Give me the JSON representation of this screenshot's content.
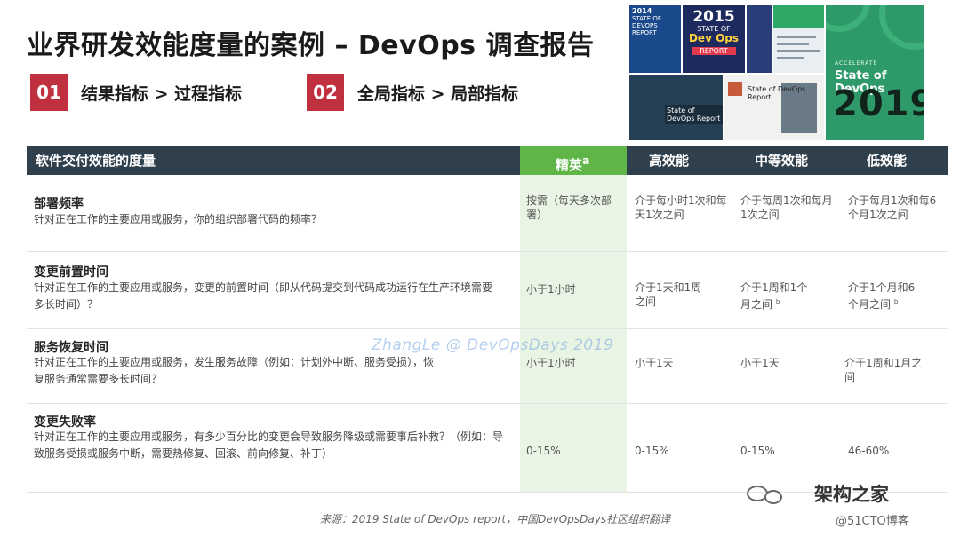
{
  "slide": {
    "title": "业界研发效能度量的案例 – DevOps 调查报告",
    "tags": [
      {
        "num": "01",
        "text": "结果指标 > 过程指标"
      },
      {
        "num": "02",
        "text": "全局指标 > 局部指标"
      }
    ]
  },
  "covers": {
    "c1_year": "2014",
    "c1_text": "STATE OF DEVOPS REPORT",
    "c2_year": "2015",
    "c2_state": "STATE OF",
    "c2_devops": "Dev Ops",
    "c2_report": "REPORT",
    "c6_text": "State of DevOps Report",
    "c7_text": "State of DevOps Report",
    "c5_accelerate": "ACCELERATE",
    "c5_title": "State of DevOps",
    "c5_year": "2019"
  },
  "table": {
    "headers": [
      "软件交付效能的度量",
      "精英",
      "高效能",
      "中等效能",
      "低效能"
    ],
    "elite_mark": "a",
    "rows": [
      {
        "metric": "部署频率",
        "desc": "针对正在工作的主要应用或服务，你的组织部署代码的频率？",
        "values": [
          "按需（每天多次部署）",
          "介于每小时1次和每天1次之间",
          "介于每周1次和每月1次之间",
          "介于每月1次和每6个月1次之间"
        ]
      },
      {
        "metric": "变更前置时间",
        "desc": "针对正在工作的主要应用或服务，变更的前置时间（即从代码提交到代码成功运行在生产环境需要多长时间）？",
        "values": [
          "小于1小时",
          "介于1天和1周之间",
          "介于1周和1个月之间",
          "介于1个月和6个月之间"
        ],
        "marks": [
          "",
          "",
          "b",
          "b"
        ]
      },
      {
        "metric": "服务恢复时间",
        "desc": "针对正在工作的主要应用或服务，发生服务故障（例如：计划外中断、服务受损），恢复服务通常需要多长时间？",
        "values": [
          "小于1小时",
          "小于1天",
          "小于1天",
          "介于1周和1月之间"
        ]
      },
      {
        "metric": "变更失败率",
        "desc": "针对正在工作的主要应用或服务，有多少百分比的变更会导致服务降级或需要事后补救？（例如：导致服务受损或服务中断，需要热修复、回滚、前向修复、补丁）",
        "values": [
          "0-15%",
          "0-15%",
          "0-15%",
          "46-60%"
        ]
      }
    ]
  },
  "watermark": "ZhangLe @ DevOpsDays 2019",
  "source": "来源：2019 State of DevOps report，中国DevOpsDays社区组织翻译",
  "wechat_name": "架构之家",
  "blog": "@51CTO博客"
}
